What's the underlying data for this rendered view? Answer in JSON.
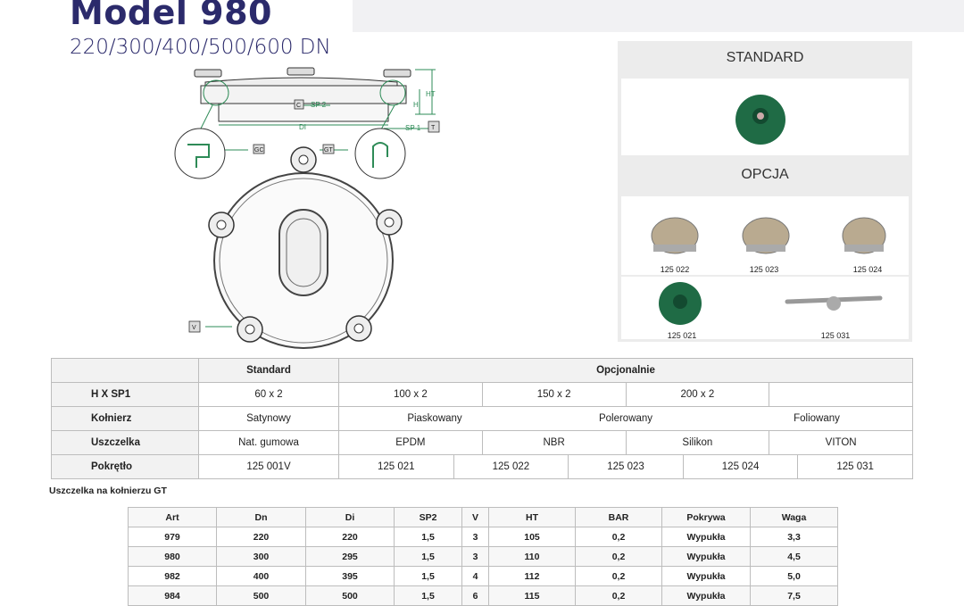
{
  "header": {
    "title": "Model 980",
    "subtitle": "220/300/400/500/600 DN"
  },
  "drawing": {
    "labels": {
      "c": "C",
      "sp2": "SP 2",
      "ht": "HT",
      "h": "H",
      "di": "DI",
      "sp1": "SP 1",
      "t": "T",
      "gc": "GC",
      "gt": "GT",
      "v": "V"
    }
  },
  "panel": {
    "standard_label": "STANDARD",
    "option_label": "OPCJA",
    "knobs": [
      "125 022",
      "125 023",
      "125 024",
      "125 021",
      "125 031"
    ]
  },
  "options_table": {
    "header": {
      "standard": "Standard",
      "optional": "Opcjonalnie"
    },
    "rows": [
      {
        "label": "H X SP1",
        "standard": "60 x 2",
        "options": [
          "100 x 2",
          "150 x 2",
          "200 x 2",
          ""
        ]
      },
      {
        "label": "Kołnierz",
        "standard": "Satynowy",
        "options": [
          "Piaskowany",
          "Polerowany",
          "Foliowany"
        ]
      },
      {
        "label": "Uszczelka",
        "standard": "Nat. gumowa",
        "options": [
          "EPDM",
          "NBR",
          "Silikon",
          "VITON"
        ]
      },
      {
        "label": "Pokrętło",
        "standard": "125 001V",
        "options": [
          "125 021",
          "125 022",
          "125 023",
          "125 024",
          "125 031"
        ]
      }
    ]
  },
  "gt_caption": "Uszczelka na kołnierzu GT",
  "art_table": {
    "columns": [
      "Art",
      "Dn",
      "Di",
      "SP2",
      "V",
      "HT",
      "BAR",
      "Pokrywa",
      "Waga"
    ],
    "rows": [
      [
        "979",
        "220",
        "220",
        "1,5",
        "3",
        "105",
        "0,2",
        "Wypukła",
        "3,3"
      ],
      [
        "980",
        "300",
        "295",
        "1,5",
        "3",
        "110",
        "0,2",
        "Wypukła",
        "4,5"
      ],
      [
        "982",
        "400",
        "395",
        "1,5",
        "4",
        "112",
        "0,2",
        "Wypukła",
        "5,0"
      ],
      [
        "984",
        "500",
        "500",
        "1,5",
        "6",
        "115",
        "0,2",
        "Wypukła",
        "7,5"
      ]
    ]
  },
  "colors": {
    "brand": "#2b2a6b",
    "dimension": "#2e8b57",
    "knob_green": "#1f6b45"
  }
}
